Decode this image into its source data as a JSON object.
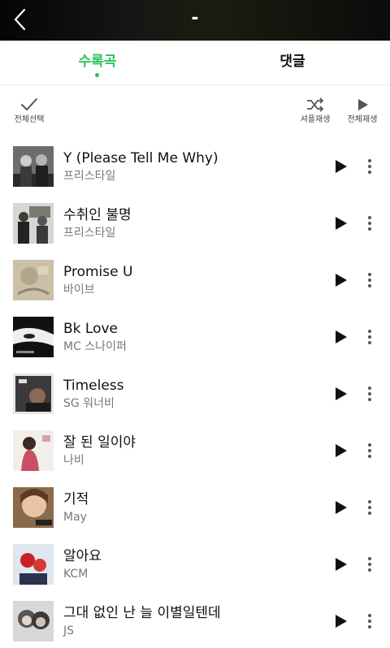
{
  "header": {
    "title": "-"
  },
  "tabs": {
    "songs": "수록곡",
    "comments": "댓글"
  },
  "toolbar": {
    "select_all": "전체선택",
    "shuffle_play": "셔플재생",
    "play_all": "전체재생"
  },
  "songs": [
    {
      "title": "Y (Please Tell Me Why)",
      "artist": "프리스타일",
      "art": "bw-duo"
    },
    {
      "title": "수취인 불명",
      "artist": "프리스타일",
      "art": "street-duo"
    },
    {
      "title": "Promise U",
      "artist": "바이브",
      "art": "sepia-abstract"
    },
    {
      "title": "Bk Love",
      "artist": "MC 스나이퍼",
      "art": "bw-face"
    },
    {
      "title": "Timeless",
      "artist": "SG 워너비",
      "art": "sg-portrait"
    },
    {
      "title": "잘 된 일이야",
      "artist": "나비",
      "art": "woman-portrait"
    },
    {
      "title": "기적",
      "artist": "May",
      "art": "vol1-portrait"
    },
    {
      "title": "알아요",
      "artist": "KCM",
      "art": "red-boxing"
    },
    {
      "title": "그대 없인 난 늘 이별일텐데",
      "artist": "JS",
      "art": "couple-bw"
    }
  ],
  "colors": {
    "accent": "#2cc35a",
    "header_bg": "#0b0b0b"
  }
}
